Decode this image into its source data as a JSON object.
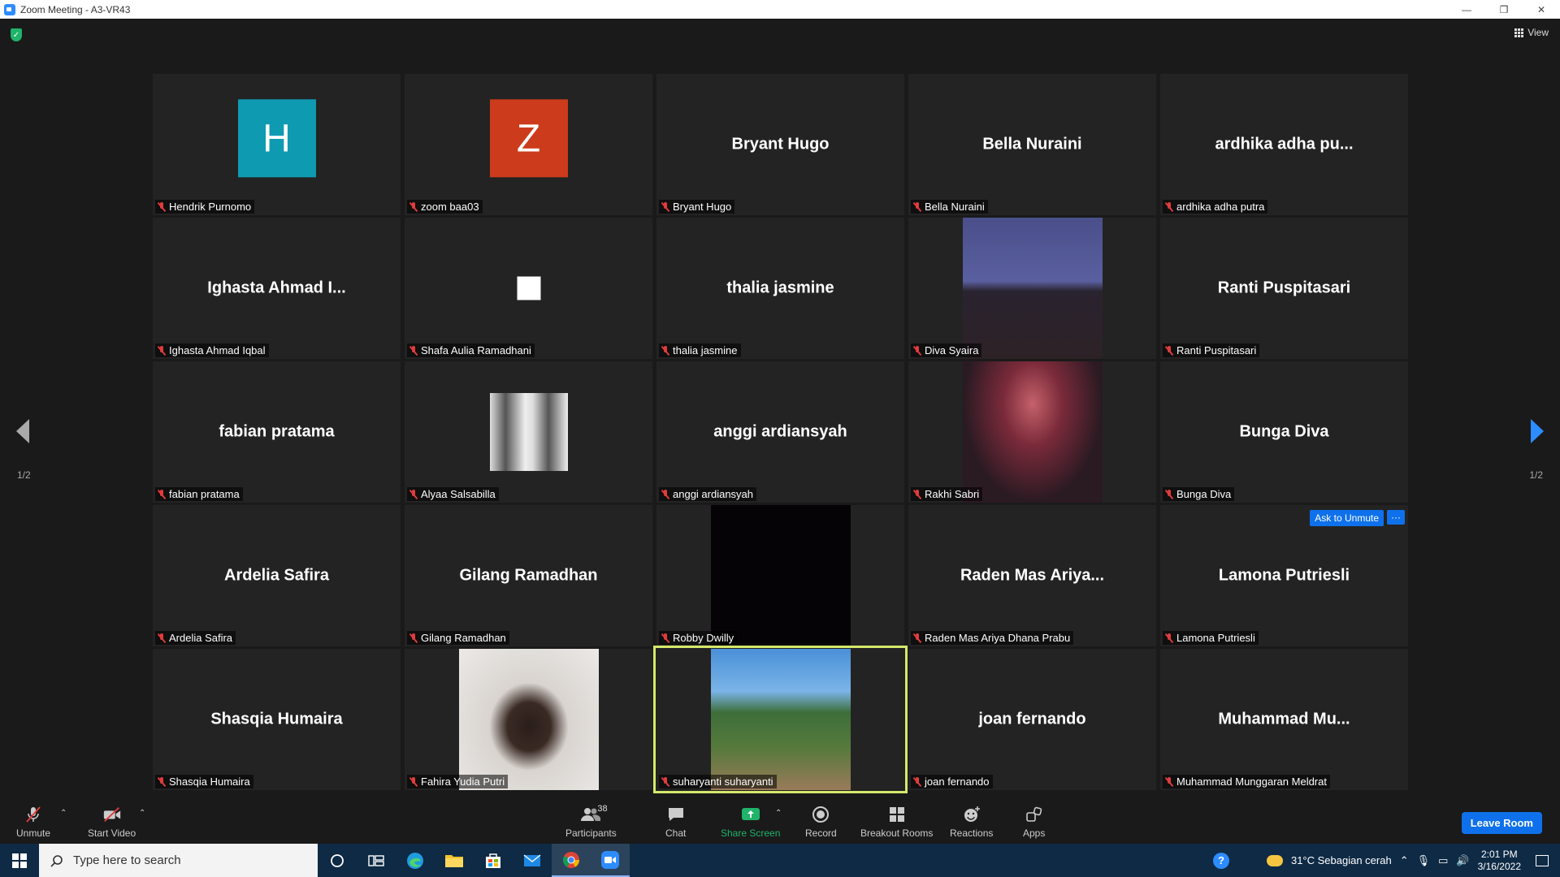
{
  "window": {
    "title": "Zoom Meeting - A3-VR43",
    "minimize": "—",
    "restore": "❐",
    "close": "✕"
  },
  "meeting": {
    "view_label": "View",
    "page_left": "1/2",
    "page_right": "1/2",
    "ask_to_unmute": "Ask to Unmute",
    "more": "···"
  },
  "participants": [
    {
      "name": "Hendrik Purnomo",
      "display": "",
      "avatar_letter": "H",
      "avatar_color": "#0e9bb2"
    },
    {
      "name": "zoom baa03",
      "display": "",
      "avatar_letter": "Z",
      "avatar_color": "#cc3b1b"
    },
    {
      "name": "Bryant Hugo",
      "display": "Bryant Hugo"
    },
    {
      "name": "Bella Nuraini",
      "display": "Bella Nuraini"
    },
    {
      "name": "ardhika adha putra",
      "display": "ardhika adha pu..."
    },
    {
      "name": "Ighasta Ahmad Iqbal",
      "display": "Ighasta Ahmad I..."
    },
    {
      "name": "Shafa Aulia Ramadhani",
      "display": ""
    },
    {
      "name": "thalia jasmine",
      "display": "thalia jasmine"
    },
    {
      "name": "Diva Syaira",
      "display": ""
    },
    {
      "name": "Ranti Puspitasari",
      "display": "Ranti Puspitasari"
    },
    {
      "name": "fabian pratama",
      "display": "fabian pratama"
    },
    {
      "name": "Alyaa Salsabilla",
      "display": ""
    },
    {
      "name": "anggi ardiansyah",
      "display": "anggi ardiansyah"
    },
    {
      "name": "Rakhi Sabri",
      "display": ""
    },
    {
      "name": "Bunga Diva",
      "display": "Bunga Diva"
    },
    {
      "name": "Ardelia Safira",
      "display": "Ardelia Safira"
    },
    {
      "name": "Gilang Ramadhan",
      "display": "Gilang Ramadhan"
    },
    {
      "name": "Robby Dwilly",
      "display": ""
    },
    {
      "name": "Raden Mas Ariya Dhana Prabu",
      "display": "Raden Mas Ariya..."
    },
    {
      "name": "Lamona Putriesli",
      "display": "Lamona Putriesli"
    },
    {
      "name": "Shasqia Humaira",
      "display": "Shasqia Humaira"
    },
    {
      "name": "Fahira Yudia Putri",
      "display": ""
    },
    {
      "name": "suharyanti suharyanti",
      "display": ""
    },
    {
      "name": "joan fernando",
      "display": "joan fernando"
    },
    {
      "name": "Muhammad Munggaran Meldrat",
      "display": "Muhammad  Mu..."
    }
  ],
  "toolbar": {
    "unmute": "Unmute",
    "start_video": "Start Video",
    "participants": "Participants",
    "participant_count": "38",
    "chat": "Chat",
    "share_screen": "Share Screen",
    "record": "Record",
    "breakout_rooms": "Breakout Rooms",
    "reactions": "Reactions",
    "apps": "Apps",
    "leave_room": "Leave Room",
    "accent": "#1fb46a"
  },
  "taskbar": {
    "search_placeholder": "Type here to search",
    "weather": "31°C  Sebagian cerah",
    "time": "2:01 PM",
    "date": "3/16/2022"
  }
}
